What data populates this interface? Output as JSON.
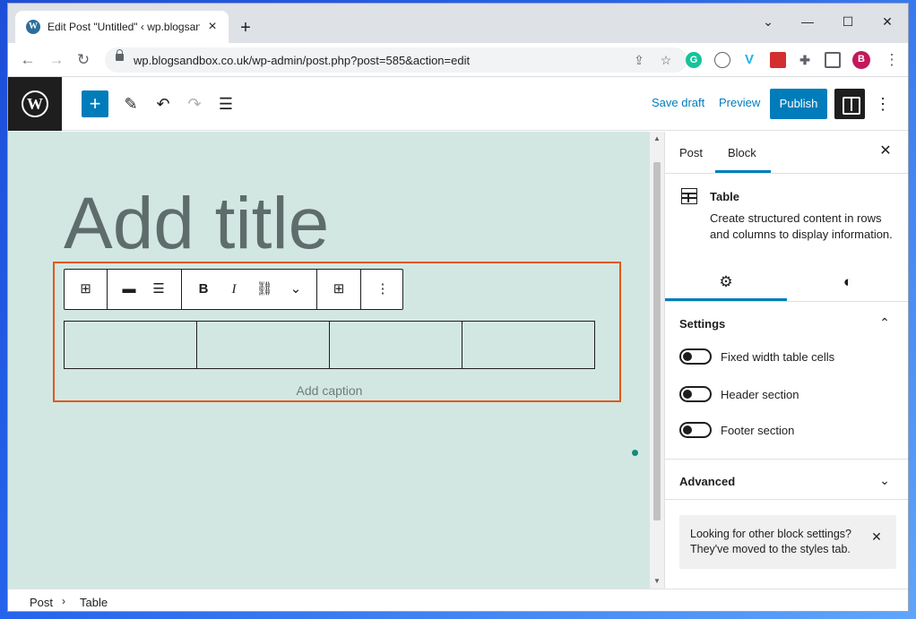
{
  "browser": {
    "tab_title": "Edit Post \"Untitled\" ‹ wp.blogsandbox.co.uk",
    "tab_favicon": "W",
    "new_tab": "+",
    "url": "wp.blogsandbox.co.uk/wp-admin/post.php?post=585&action=edit",
    "profile_initial": "B",
    "extension_vimeo": "V",
    "extension_grammarly": "G"
  },
  "topbar": {
    "save_draft": "Save draft",
    "preview": "Preview",
    "publish": "Publish"
  },
  "editor": {
    "title_placeholder": "Add title",
    "caption_placeholder": "Add caption",
    "table_columns": 4,
    "toolbar_bold": "B",
    "toolbar_italic": "I"
  },
  "sidebar": {
    "tabs": [
      "Post",
      "Block"
    ],
    "active_tab": "Block",
    "block_name": "Table",
    "block_description": "Create structured content in rows and columns to display information.",
    "settings_title": "Settings",
    "toggles": [
      "Fixed width table cells",
      "Header section",
      "Footer section"
    ],
    "advanced_title": "Advanced",
    "notice": "Looking for other block settings? They've moved to the styles tab."
  },
  "breadcrumb": [
    "Post",
    "Table"
  ],
  "colors": {
    "accent": "#007cba",
    "canvas": "#d3e7e2",
    "selection_outline": "#e2581a"
  },
  "icons": [
    "wordpress-logo-icon",
    "plus-icon",
    "pencil-icon",
    "undo-icon",
    "redo-icon",
    "list-view-icon",
    "table-icon",
    "align-icon",
    "column-align-icon",
    "bold-icon",
    "italic-icon",
    "link-icon",
    "chevron-down-icon",
    "edit-table-icon",
    "more-vertical-icon",
    "gear-icon",
    "contrast-icon",
    "close-icon",
    "chevron-up-icon"
  ]
}
